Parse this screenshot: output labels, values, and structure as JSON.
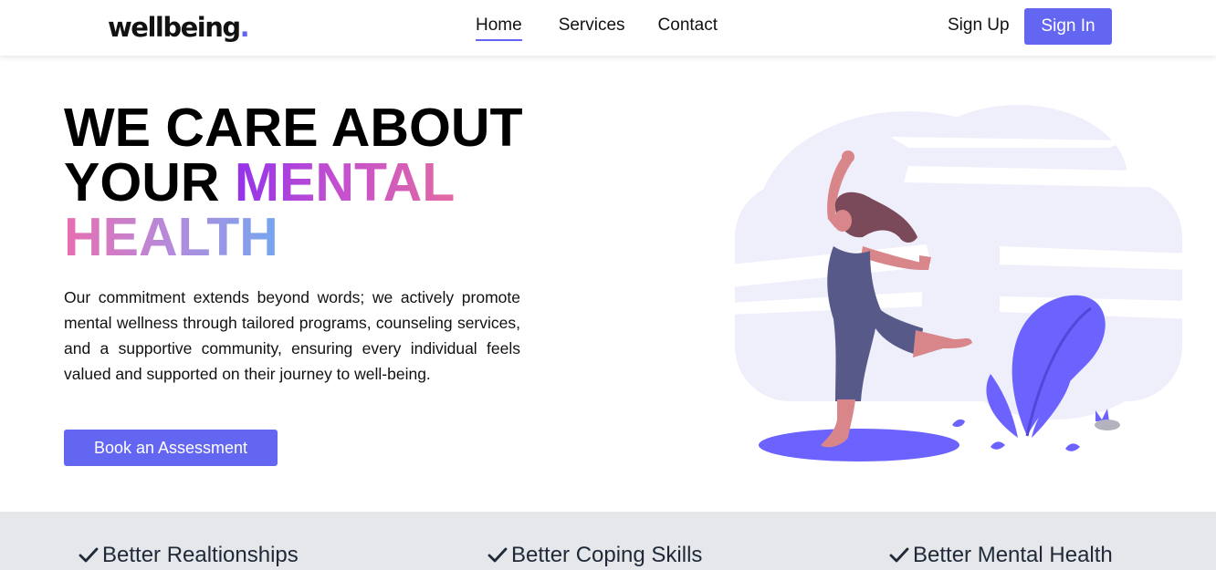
{
  "nav": {
    "logo_text": "wellbeing",
    "logo_dot": ".",
    "links": [
      "Home",
      "Services",
      "Contact"
    ],
    "signup_label": "Sign Up",
    "signin_label": "Sign In"
  },
  "hero": {
    "title_line1": "WE CARE ABOUT",
    "title_line2_plain": "YOUR ",
    "title_line2_accent": "MENTAL",
    "title_line3_accent": "HEALTH",
    "description": "Our commitment extends beyond words; we actively promote mental wellness through tailored programs, counseling services, and a supportive community, ensuring every individual feels valued and supported on their journey to well-being.",
    "cta_label": "Book an Assessment"
  },
  "features": [
    {
      "label": "Better Realtionships",
      "icon": "check-icon"
    },
    {
      "label": "Better Coping Skills",
      "icon": "check-icon"
    },
    {
      "label": "Better Mental Health",
      "icon": "check-icon"
    }
  ],
  "colors": {
    "accent": "#6366f1",
    "features_bg": "#e5e7eb",
    "illustration_bg": "#efeefb"
  }
}
